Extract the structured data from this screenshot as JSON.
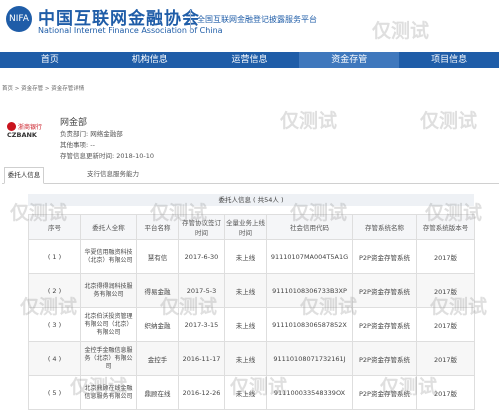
{
  "header": {
    "logo_badge": "NIFA",
    "title_cn": "中国互联网金融协会",
    "title_en": "National Internet Finance Association of China",
    "slogan": "全国互联网金融登记披露服务平台"
  },
  "nav": [
    {
      "label": "首页"
    },
    {
      "label": "机构信息"
    },
    {
      "label": "运营信息"
    },
    {
      "label": "资金存管"
    },
    {
      "label": "项目信息"
    }
  ],
  "breadcrumb": "首页 > 资金存管 > 资金存管详情",
  "institution": {
    "logo_cn": "浙商银行",
    "logo_en": "CZBANK",
    "name": "网金部",
    "department": "负责部门: 网络金融部",
    "other": "其他事项: --",
    "updated": "存管信息更新时间: 2018-10-10"
  },
  "tabs": [
    {
      "label": "委托人信息"
    },
    {
      "label": "支行信息服务能力"
    }
  ],
  "agency_header": "委托人信息 ( 共54人 )",
  "table": {
    "columns": [
      "序号",
      "委托人全称",
      "平台名称",
      "存管协议签订时间",
      "全量业务上线时间",
      "社会信用代码",
      "存管系统名称",
      "存管系统版本号"
    ],
    "rows": [
      {
        "no": "( 1 )",
        "name": "华夏信用融资科技（北京）有限公司",
        "platform": "慧有信",
        "sign": "2017-6-30",
        "online": "未上线",
        "code": "91110107MA004T5A1G",
        "system": "P2P资金存管系统",
        "version": "2017版"
      },
      {
        "no": "( 2 )",
        "name": "北京得得润科技服务有限公司",
        "platform": "得易金融",
        "sign": "2017-5-3",
        "online": "未上线",
        "code": "91110108306733B3XP",
        "system": "P2P资金存管系统",
        "version": "2017版"
      },
      {
        "no": "( 3 )",
        "name": "北京伯沃投资管理有限公司（北京）有限公司",
        "platform": "织纳金融",
        "sign": "2017-3-15",
        "online": "未上线",
        "code": "91110108306587852X",
        "system": "P2P资金存管系统",
        "version": "2017版"
      },
      {
        "no": "( 4 )",
        "name": "金控手金融信息服务（北京）有限公司",
        "platform": "金控手",
        "sign": "2016-11-17",
        "online": "未上线",
        "code": "91110108071732161J",
        "system": "P2P资金存管系统",
        "version": "2017版"
      },
      {
        "no": "( 5 )",
        "name": "北京鼎顾在线金融信息服务有限公司",
        "platform": "鼎顾在线",
        "sign": "2016-12-26",
        "online": "未上线",
        "code": "911100033548339OX",
        "system": "P2P资金存管系统",
        "version": "2017版"
      }
    ]
  },
  "watermark": "仅测试"
}
